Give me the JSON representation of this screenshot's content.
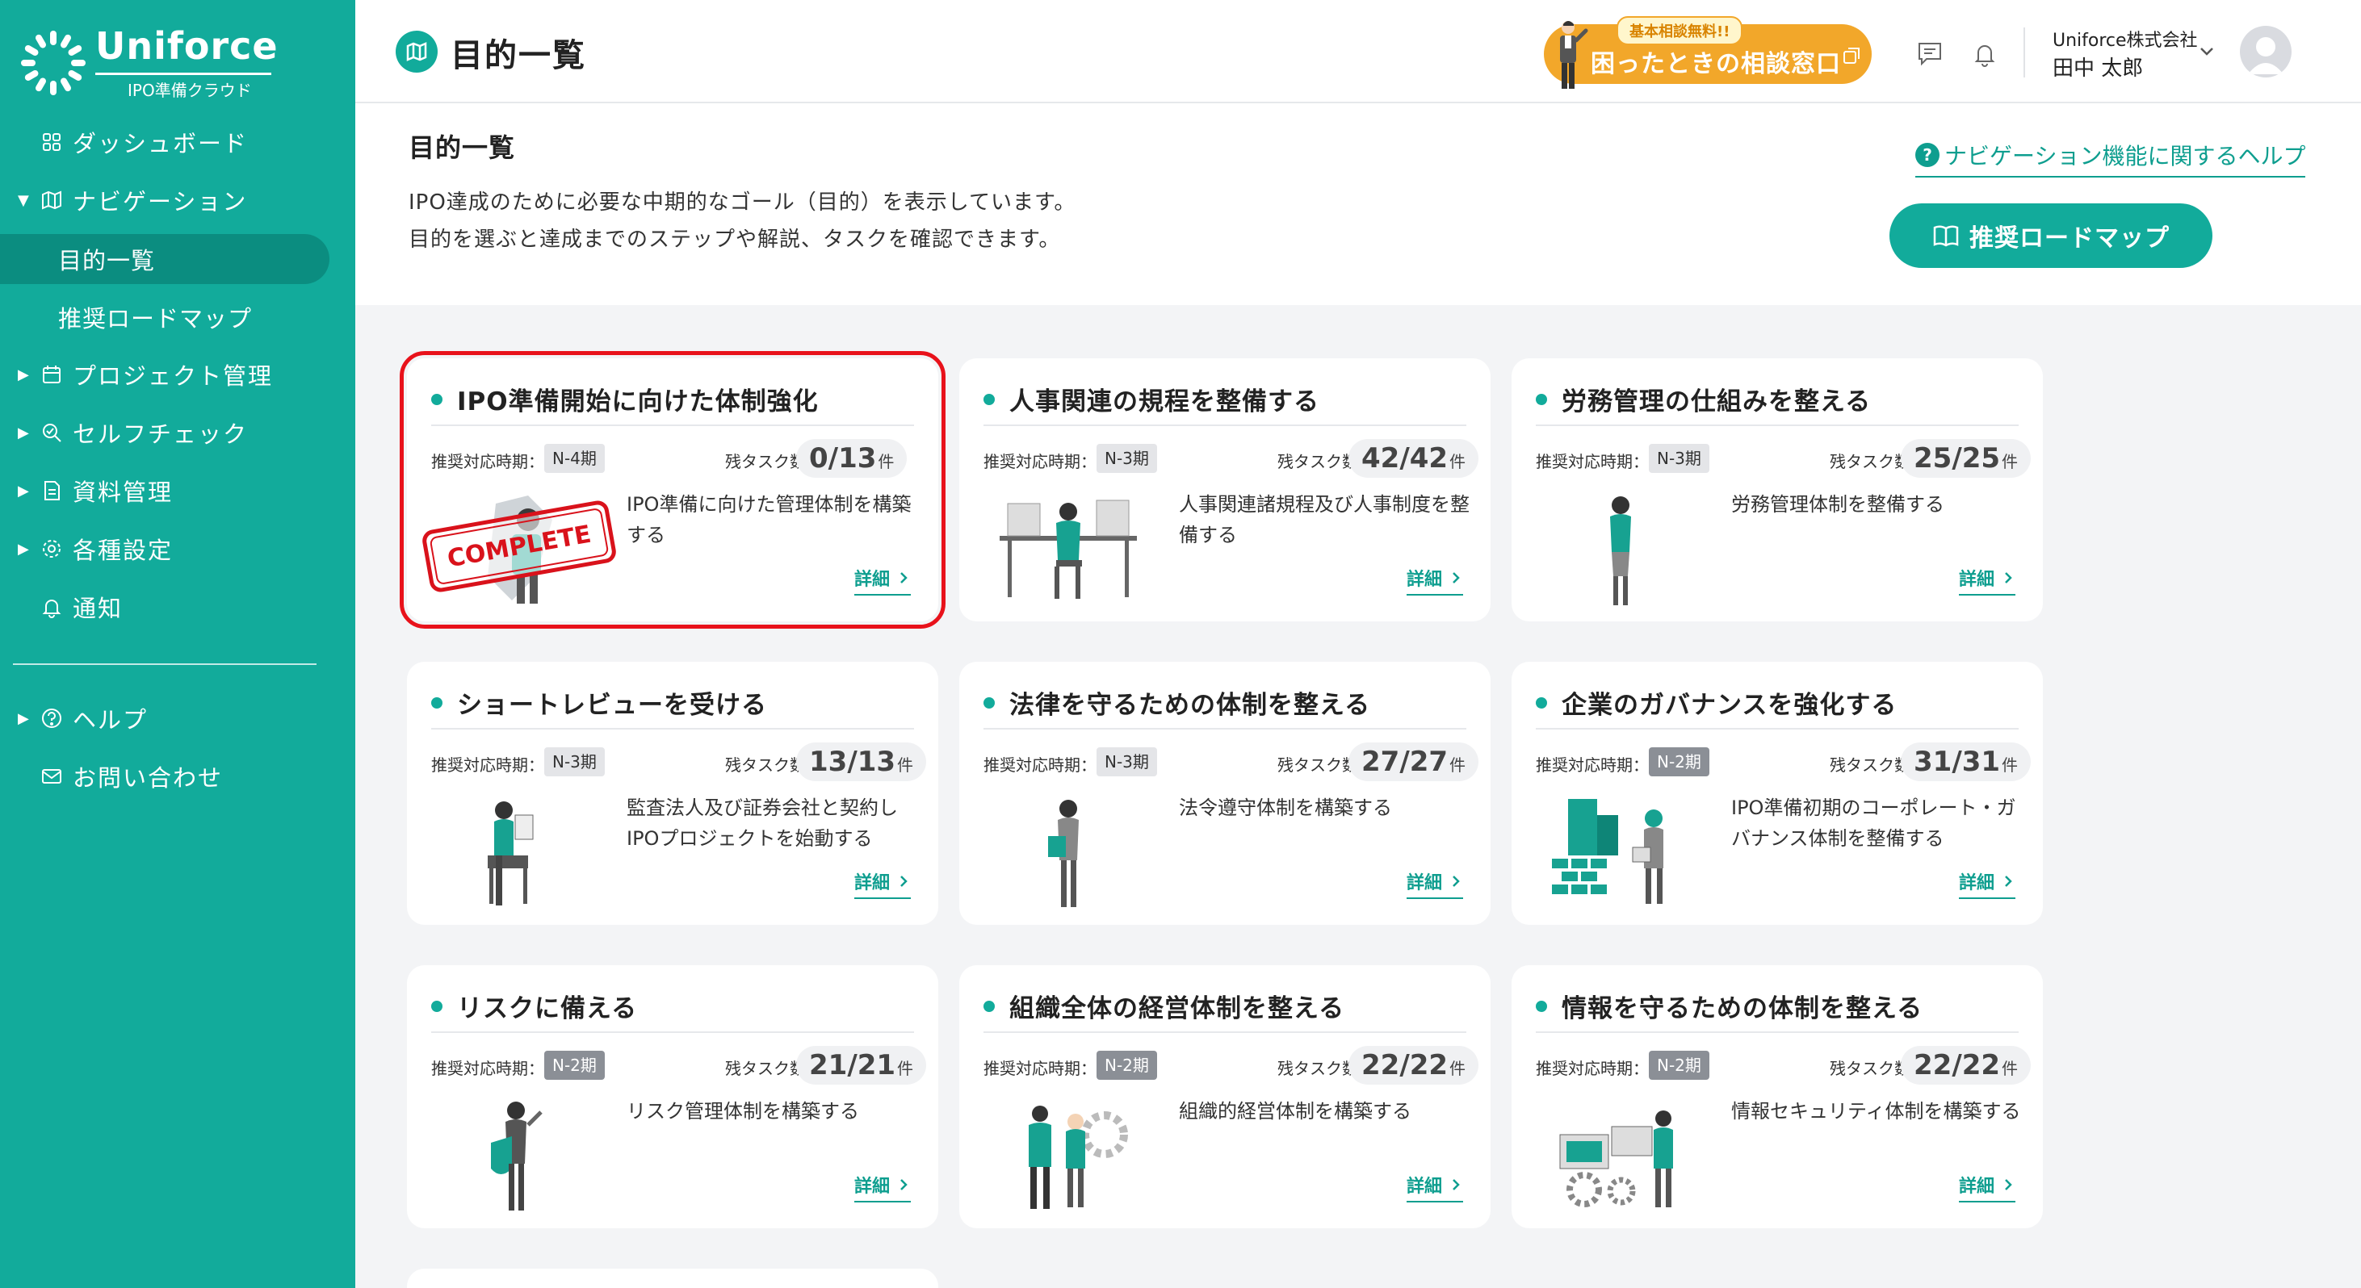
{
  "sidebar": {
    "logo_name": "Uniforce",
    "logo_sub": "IPO準備クラウド",
    "items": [
      {
        "label": "ダッシュボード"
      },
      {
        "label": "ナビゲーション"
      },
      {
        "label": "目的一覧"
      },
      {
        "label": "推奨ロードマップ"
      },
      {
        "label": "プロジェクト管理"
      },
      {
        "label": "セルフチェック"
      },
      {
        "label": "資料管理"
      },
      {
        "label": "各種設定"
      },
      {
        "label": "通知"
      },
      {
        "label": "ヘルプ"
      },
      {
        "label": "お問い合わせ"
      }
    ]
  },
  "header": {
    "title": "目的一覧",
    "consult_badge": "基本相談無料!!",
    "consult_label": "困ったときの相談窓口",
    "company": "Uniforce株式会社",
    "user": "田中 太郎"
  },
  "intro": {
    "title": "目的一覧",
    "line1": "IPO達成のために必要な中期的なゴール（目的）を表示しています。",
    "line2": "目的を選ぶと達成までのステップや解説、タスクを確認できます。",
    "help_link": "ナビゲーション機能に関するヘルプ",
    "roadmap_button": "推奨ロードマップ"
  },
  "labels": {
    "period": "推奨対応時期：",
    "tasks": "残タスク数",
    "unit": "件",
    "detail": "詳細",
    "complete": "COMPLETE"
  },
  "cards": [
    {
      "title": "IPO準備開始に向けた体制強化",
      "period": "N-4期",
      "tasks": "0/13",
      "desc": "IPO準備に向けた管理体制を構築する",
      "complete": true
    },
    {
      "title": "人事関連の規程を整備する",
      "period": "N-3期",
      "tasks": "42/42",
      "desc": "人事関連諸規程及び人事制度を整備する"
    },
    {
      "title": "労務管理の仕組みを整える",
      "period": "N-3期",
      "tasks": "25/25",
      "desc": "労務管理体制を整備する"
    },
    {
      "title": "ショートレビューを受ける",
      "period": "N-3期",
      "tasks": "13/13",
      "desc": "監査法人及び証券会社と契約しIPOプロジェクトを始動する"
    },
    {
      "title": "法律を守るための体制を整える",
      "period": "N-3期",
      "tasks": "27/27",
      "desc": "法令遵守体制を構築する"
    },
    {
      "title": "企業のガバナンスを強化する",
      "period": "N-2期",
      "tasks": "31/31",
      "desc": "IPO準備初期のコーポレート・ガバナンス体制を整備する"
    },
    {
      "title": "リスクに備える",
      "period": "N-2期",
      "tasks": "21/21",
      "desc": "リスク管理体制を構築する"
    },
    {
      "title": "組織全体の経営体制を整える",
      "period": "N-2期",
      "tasks": "22/22",
      "desc": "組織的経営体制を構築する"
    },
    {
      "title": "情報を守るための体制を整える",
      "period": "N-2期",
      "tasks": "22/22",
      "desc": "情報セキュリティ体制を構築する"
    }
  ],
  "colors": {
    "brand": "#12ab9b",
    "brand_dark": "#0b8d80",
    "accent": "#f2a72a",
    "highlight": "#e8121b"
  }
}
